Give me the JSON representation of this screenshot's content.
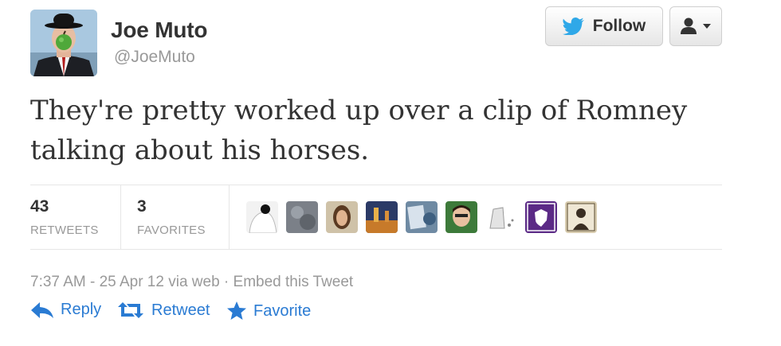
{
  "user": {
    "name": "Joe Muto",
    "handle": "@JoeMuto"
  },
  "header": {
    "follow_label": "Follow",
    "user_menu_icon": "person-dropdown-icon"
  },
  "tweet": {
    "text": "They're pretty worked up over a clip of Romney talking about his horses."
  },
  "stats": {
    "retweets_count": "43",
    "retweets_label": "RETWEETS",
    "favorites_count": "3",
    "favorites_label": "FAVORITES",
    "favoriter_avatars": 9
  },
  "meta": {
    "timestamp": "7:37 AM - 25 Apr 12 via web",
    "separator": "·",
    "embed_label": "Embed this Tweet"
  },
  "actions": {
    "reply_label": "Reply",
    "retweet_label": "Retweet",
    "favorite_label": "Favorite"
  },
  "colors": {
    "link": "#2a7bd3",
    "muted": "#999999",
    "text": "#333333",
    "twitter_bird": "#2fa8e8"
  }
}
